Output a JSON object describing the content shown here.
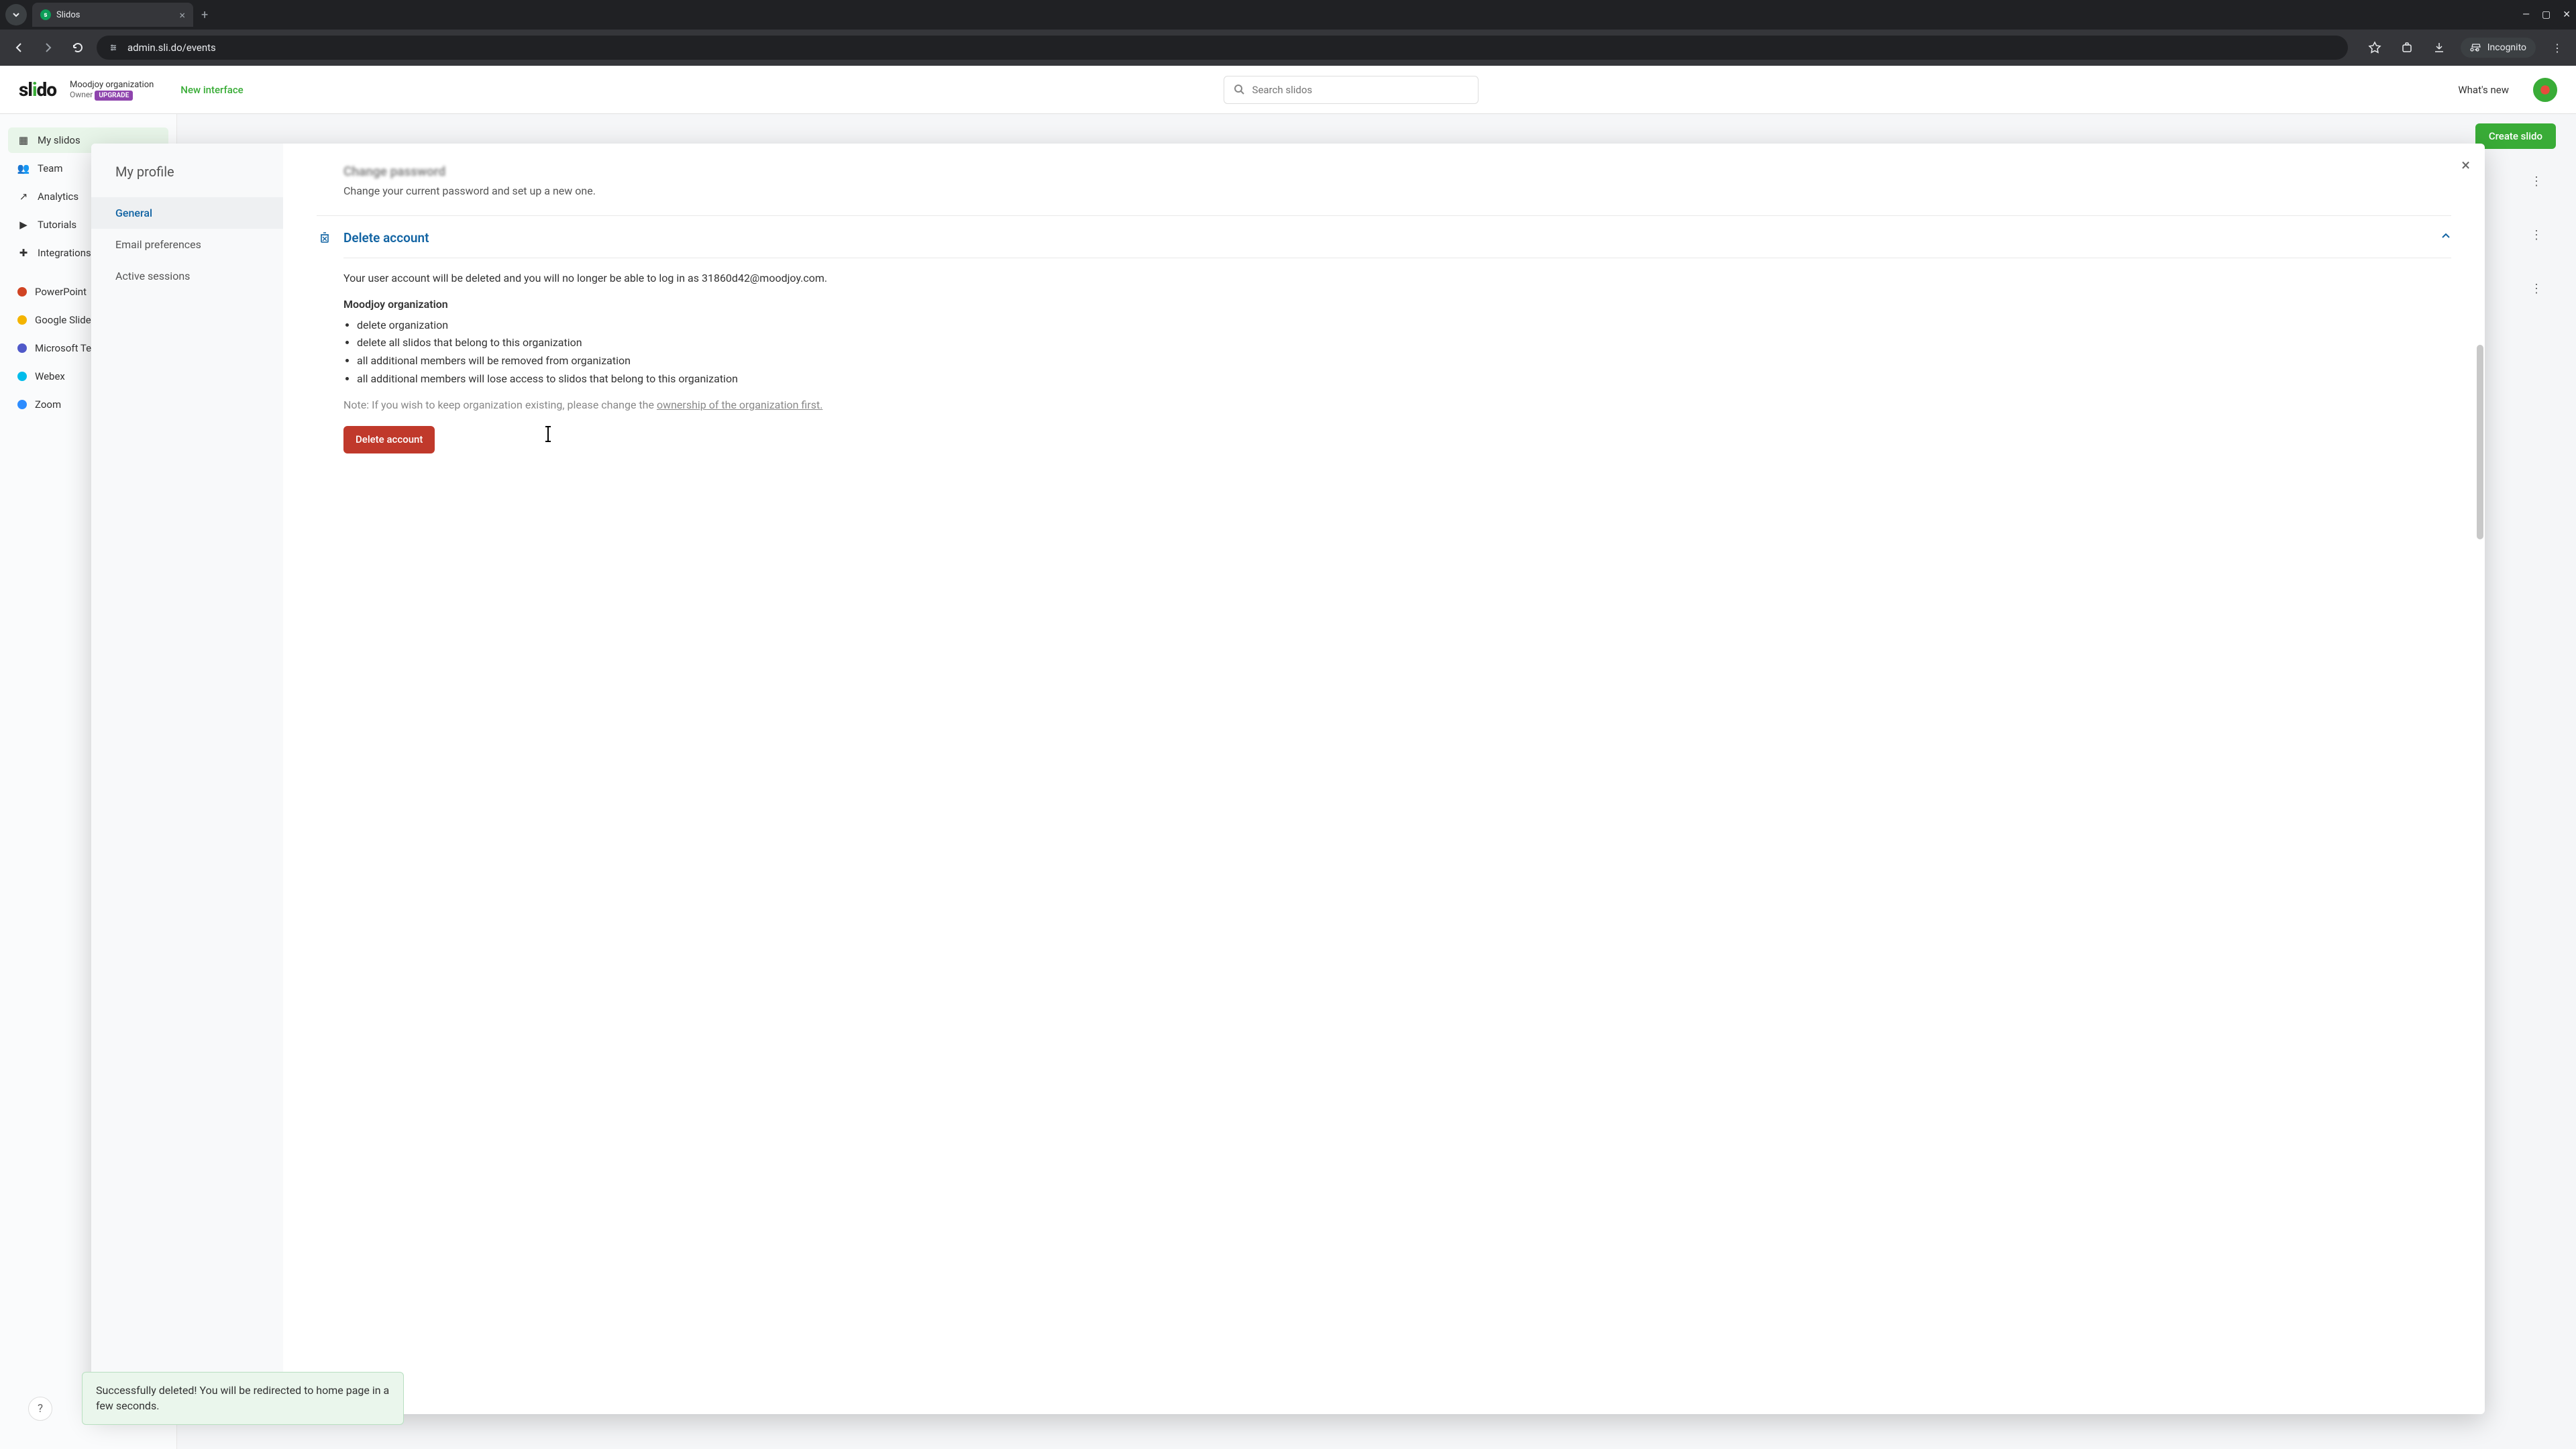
{
  "browser": {
    "tab_title": "Slidos",
    "url": "admin.sli.do/events",
    "incognito_label": "Incognito"
  },
  "header": {
    "logo": "slido",
    "org_name": "Moodjoy organization",
    "org_role": "Owner",
    "upgrade": "UPGRADE",
    "new_interface": "New interface",
    "search_placeholder": "Search slidos",
    "whats_new": "What's new"
  },
  "sidebar": {
    "items": [
      {
        "label": "My slidos"
      },
      {
        "label": "Team"
      },
      {
        "label": "Analytics"
      },
      {
        "label": "Tutorials"
      },
      {
        "label": "Integrations"
      }
    ],
    "integrations": [
      {
        "label": "PowerPoint"
      },
      {
        "label": "Google Slides"
      },
      {
        "label": "Microsoft Teams"
      },
      {
        "label": "Webex"
      },
      {
        "label": "Zoom"
      }
    ]
  },
  "main": {
    "create_label": "Create slido"
  },
  "modal": {
    "title": "My profile",
    "tabs": {
      "general": "General",
      "email": "Email preferences",
      "sessions": "Active sessions"
    },
    "change_pw": {
      "title": "Change password",
      "sub": "Change your current password and set up a new one."
    },
    "delete": {
      "title": "Delete account",
      "intro": "Your user account will be deleted and you will no longer be able to log in as 31860d42@moodjoy.com.",
      "org": "Moodjoy organization",
      "bullets": [
        "delete organization",
        "delete all slidos that belong to this organization",
        "all additional members will be removed from organization",
        "all additional members will lose access to slidos that belong to this organization"
      ],
      "note_prefix": "Note: If you wish to keep organization existing, please change the ",
      "note_link": "ownership of the organization first.",
      "button": "Delete account"
    }
  },
  "toast": {
    "text": "Successfully deleted! You will be redirected to home page in a few seconds."
  }
}
